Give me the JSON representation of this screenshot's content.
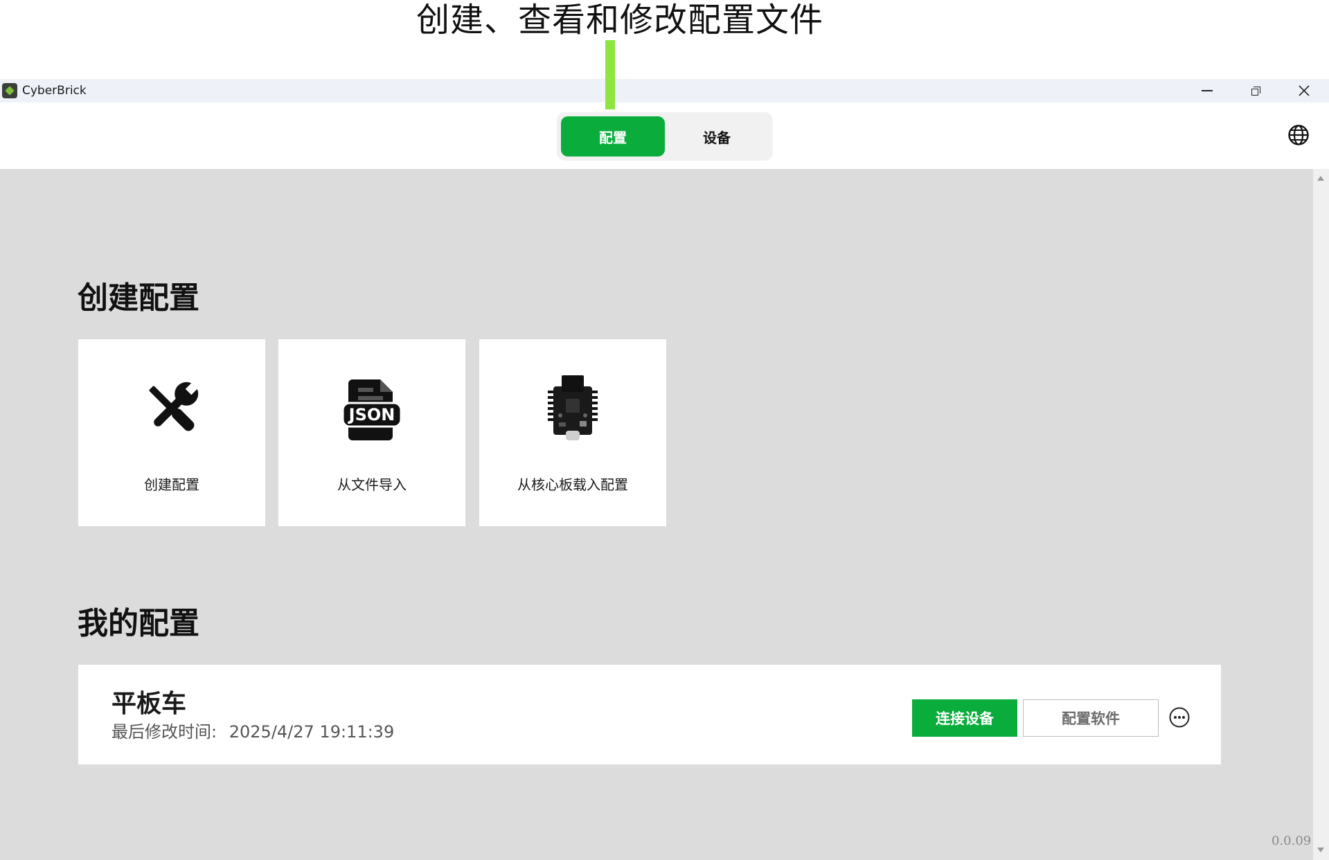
{
  "annotation": {
    "text": "创建、查看和修改配置文件",
    "arrow_color": "#8ee53f"
  },
  "window": {
    "title": "CyberBrick",
    "controls": [
      "minimize",
      "restore",
      "close"
    ]
  },
  "header": {
    "tabs": [
      {
        "label": "配置",
        "active": true
      },
      {
        "label": "设备",
        "active": false
      }
    ],
    "language_icon": "globe-icon",
    "accent_color": "#0aad3c"
  },
  "create_section": {
    "title": "创建配置",
    "cards": [
      {
        "label": "创建配置",
        "icon": "tools-icon"
      },
      {
        "label": "从文件导入",
        "icon": "json-file-icon",
        "icon_text": "JSON"
      },
      {
        "label": "从核心板载入配置",
        "icon": "core-board-icon"
      }
    ]
  },
  "my_section": {
    "title": "我的配置",
    "configs": [
      {
        "name": "平板车",
        "time_label": "最后修改时间:",
        "time_value": "2025/4/27 19:11:39",
        "connect_label": "连接设备",
        "software_label": "配置软件",
        "more_icon": "more-icon"
      }
    ]
  },
  "footer": {
    "version": "0.0.09"
  }
}
